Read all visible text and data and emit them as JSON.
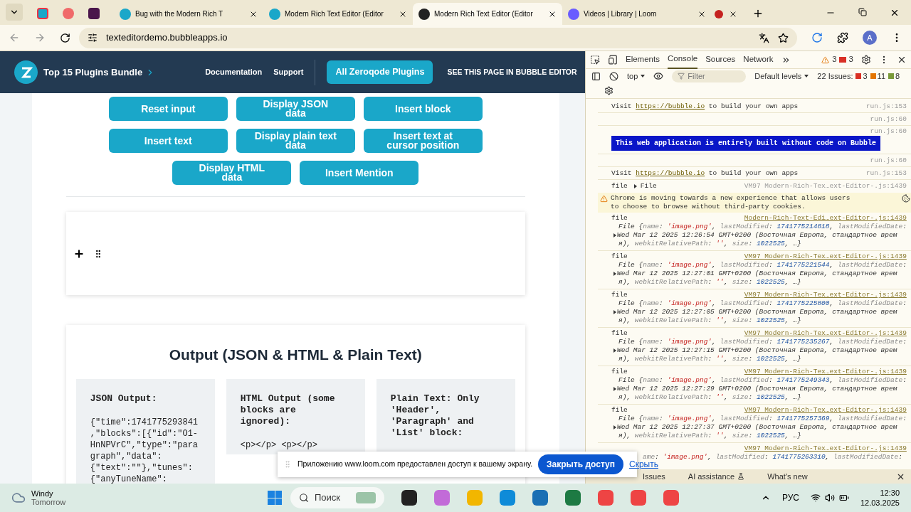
{
  "browser": {
    "tabs": [
      {
        "title": "Bug with the Modern Rich T",
        "selected": false
      },
      {
        "title": "Modern Rich Text Editor (Editor",
        "selected": false
      },
      {
        "title": "Modern Rich Text Editor (Editor",
        "selected": true
      },
      {
        "title": "Videos | Library | Loom",
        "selected": false
      }
    ],
    "url": "texteditordemo.bubbleapps.io",
    "profile": "A"
  },
  "page": {
    "brand": "Top 15 Plugins Bundle",
    "nav": [
      "Documentation",
      "Support"
    ],
    "cta": "All Zeroqode Plugins",
    "editor_link": "SEE THIS PAGE IN BUBBLE EDITOR",
    "button_rows": [
      [
        "Reset input",
        "Display JSON data",
        "Insert block"
      ],
      [
        "Insert text",
        "Display plain text data",
        "Insert text at cursor position"
      ],
      [
        "Display HTML data",
        "Insert Mention"
      ]
    ],
    "output_title": "Output (JSON & HTML & Plain Text)",
    "panels": [
      {
        "heading": "JSON Output:",
        "lines": [
          "{\"time\":1741775293841",
          ",\"blocks\":[{\"id\":\"O1-",
          "HnNPVrC\",\"type\":\"para",
          "graph\",\"data\":",
          "{\"text\":\"\"},\"tunes\":",
          "{\"anyTuneName\":"
        ]
      },
      {
        "heading": "HTML Output (some blocks are ignored):",
        "lines": [
          "<p></p> <p></p>"
        ]
      },
      {
        "heading": "Plain Text: Only 'Header', 'Paragraph' and 'List' block:"
      }
    ]
  },
  "devtools": {
    "tabs": [
      {
        "label": "Elements",
        "selected": false
      },
      {
        "label": "Console",
        "selected": true
      },
      {
        "label": "Sources",
        "selected": false
      },
      {
        "label": "Network",
        "selected": false
      }
    ],
    "warnings": "3",
    "errors": "3",
    "context": "top",
    "filter_placeholder": "Filter",
    "levels": "Default levels",
    "issues_label": "22 Issues:",
    "issue_counts": [
      "3",
      "11",
      "8"
    ],
    "messages": [
      {
        "kind": "visit",
        "before": "Visit ",
        "link": "https://bubble.io",
        "after": " to build your own apps",
        "source": "run.js:153"
      },
      {
        "kind": "empty",
        "source": "run.js:60"
      },
      {
        "kind": "banner",
        "source": "run.js:60",
        "text": "This web application is entirely built without code on Bubble"
      },
      {
        "kind": "empty",
        "source": "run.js:60"
      },
      {
        "kind": "visit",
        "before": "Visit ",
        "link": "https://bubble.io",
        "after": " to build your own apps",
        "source": "run.js:153"
      },
      {
        "kind": "collapsed",
        "label": "file",
        "summary": "File",
        "source": "VM97 Modern-Rich-Tex…ext-Editor-.js:1439"
      },
      {
        "kind": "warning",
        "text": "Chrome is moving towards a new experience that allows users to choose to browse without third-party cookies."
      },
      {
        "kind": "file",
        "label": "file",
        "source": "Modern-Rich-Text-Edi…ext-Editor-.js:1439",
        "lines": [
          [
            {
              "kind": "p",
              "t": "File {"
            },
            {
              "kind": "key",
              "t": "name"
            },
            {
              "kind": "p",
              "t": ": "
            },
            {
              "kind": "str",
              "t": "'image.png'"
            },
            {
              "kind": "p",
              "t": ", "
            },
            {
              "kind": "key",
              "t": "lastModified"
            },
            {
              "kind": "p",
              "t": ": "
            },
            {
              "kind": "num",
              "t": "1741775214818"
            },
            {
              "kind": "p",
              "t": ", "
            },
            {
              "kind": "key",
              "t": "lastModifiedDate"
            },
            {
              "kind": "p",
              "t": ":"
            }
          ],
          [
            {
              "kind": "p",
              "t": "Wed Mar 12 2025 12:26:54 GMT+0200 (Восточная Европа, стандартное врем"
            }
          ],
          [
            {
              "kind": "p",
              "t": "я), "
            },
            {
              "kind": "key",
              "t": "webkitRelativePath"
            },
            {
              "kind": "p",
              "t": ": "
            },
            {
              "kind": "str",
              "t": "''"
            },
            {
              "kind": "p",
              "t": ", "
            },
            {
              "kind": "key",
              "t": "size"
            },
            {
              "kind": "p",
              "t": ": "
            },
            {
              "kind": "num",
              "t": "1022525"
            },
            {
              "kind": "p",
              "t": ", …}"
            }
          ]
        ]
      },
      {
        "kind": "file",
        "label": "file",
        "source": "VM97 Modern-Rich-Tex…ext-Editor-.js:1439",
        "lines": [
          [
            {
              "kind": "p",
              "t": "File {"
            },
            {
              "kind": "key",
              "t": "name"
            },
            {
              "kind": "p",
              "t": ": "
            },
            {
              "kind": "str",
              "t": "'image.png'"
            },
            {
              "kind": "p",
              "t": ", "
            },
            {
              "kind": "key",
              "t": "lastModified"
            },
            {
              "kind": "p",
              "t": ": "
            },
            {
              "kind": "num",
              "t": "1741775221544"
            },
            {
              "kind": "p",
              "t": ", "
            },
            {
              "kind": "key",
              "t": "lastModifiedDate"
            },
            {
              "kind": "p",
              "t": ":"
            }
          ],
          [
            {
              "kind": "p",
              "t": "Wed Mar 12 2025 12:27:01 GMT+0200 (Восточная Европа, стандартное врем"
            }
          ],
          [
            {
              "kind": "p",
              "t": "я), "
            },
            {
              "kind": "key",
              "t": "webkitRelativePath"
            },
            {
              "kind": "p",
              "t": ": "
            },
            {
              "kind": "str",
              "t": "''"
            },
            {
              "kind": "p",
              "t": ", "
            },
            {
              "kind": "key",
              "t": "size"
            },
            {
              "kind": "p",
              "t": ": "
            },
            {
              "kind": "num",
              "t": "1022525"
            },
            {
              "kind": "p",
              "t": ", …}"
            }
          ]
        ]
      },
      {
        "kind": "file",
        "label": "file",
        "source": "VM97 Modern-Rich-Tex…ext-Editor-.js:1439",
        "lines": [
          [
            {
              "kind": "p",
              "t": "File {"
            },
            {
              "kind": "key",
              "t": "name"
            },
            {
              "kind": "p",
              "t": ": "
            },
            {
              "kind": "str",
              "t": "'image.png'"
            },
            {
              "kind": "p",
              "t": ", "
            },
            {
              "kind": "key",
              "t": "lastModified"
            },
            {
              "kind": "p",
              "t": ": "
            },
            {
              "kind": "num",
              "t": "1741775225800"
            },
            {
              "kind": "p",
              "t": ", "
            },
            {
              "kind": "key",
              "t": "lastModifiedDate"
            },
            {
              "kind": "p",
              "t": ":"
            }
          ],
          [
            {
              "kind": "p",
              "t": "Wed Mar 12 2025 12:27:05 GMT+0200 (Восточная Европа, стандартное врем"
            }
          ],
          [
            {
              "kind": "p",
              "t": "я), "
            },
            {
              "kind": "key",
              "t": "webkitRelativePath"
            },
            {
              "kind": "p",
              "t": ": "
            },
            {
              "kind": "str",
              "t": "''"
            },
            {
              "kind": "p",
              "t": ", "
            },
            {
              "kind": "key",
              "t": "size"
            },
            {
              "kind": "p",
              "t": ": "
            },
            {
              "kind": "num",
              "t": "1022525"
            },
            {
              "kind": "p",
              "t": ", …}"
            }
          ]
        ]
      },
      {
        "kind": "file",
        "label": "file",
        "source": "VM97 Modern-Rich-Tex…ext-Editor-.js:1439",
        "lines": [
          [
            {
              "kind": "p",
              "t": "File {"
            },
            {
              "kind": "key",
              "t": "name"
            },
            {
              "kind": "p",
              "t": ": "
            },
            {
              "kind": "str",
              "t": "'image.png'"
            },
            {
              "kind": "p",
              "t": ", "
            },
            {
              "kind": "key",
              "t": "lastModified"
            },
            {
              "kind": "p",
              "t": ": "
            },
            {
              "kind": "num",
              "t": "1741775235267"
            },
            {
              "kind": "p",
              "t": ", "
            },
            {
              "kind": "key",
              "t": "lastModifiedDate"
            },
            {
              "kind": "p",
              "t": ":"
            }
          ],
          [
            {
              "kind": "p",
              "t": "Wed Mar 12 2025 12:27:15 GMT+0200 (Восточная Европа, стандартное врем"
            }
          ],
          [
            {
              "kind": "p",
              "t": "я), "
            },
            {
              "kind": "key",
              "t": "webkitRelativePath"
            },
            {
              "kind": "p",
              "t": ": "
            },
            {
              "kind": "str",
              "t": "''"
            },
            {
              "kind": "p",
              "t": ", "
            },
            {
              "kind": "key",
              "t": "size"
            },
            {
              "kind": "p",
              "t": ": "
            },
            {
              "kind": "num",
              "t": "1022525"
            },
            {
              "kind": "p",
              "t": ", …}"
            }
          ]
        ]
      },
      {
        "kind": "file",
        "label": "file",
        "source": "VM97 Modern-Rich-Tex…ext-Editor-.js:1439",
        "lines": [
          [
            {
              "kind": "p",
              "t": "File {"
            },
            {
              "kind": "key",
              "t": "name"
            },
            {
              "kind": "p",
              "t": ": "
            },
            {
              "kind": "str",
              "t": "'image.png'"
            },
            {
              "kind": "p",
              "t": ", "
            },
            {
              "kind": "key",
              "t": "lastModified"
            },
            {
              "kind": "p",
              "t": ": "
            },
            {
              "kind": "num",
              "t": "1741775249343"
            },
            {
              "kind": "p",
              "t": ", "
            },
            {
              "kind": "key",
              "t": "lastModifiedDate"
            },
            {
              "kind": "p",
              "t": ":"
            }
          ],
          [
            {
              "kind": "p",
              "t": "Wed Mar 12 2025 12:27:29 GMT+0200 (Восточная Европа, стандартное врем"
            }
          ],
          [
            {
              "kind": "p",
              "t": "я), "
            },
            {
              "kind": "key",
              "t": "webkitRelativePath"
            },
            {
              "kind": "p",
              "t": ": "
            },
            {
              "kind": "str",
              "t": "''"
            },
            {
              "kind": "p",
              "t": ", "
            },
            {
              "kind": "key",
              "t": "size"
            },
            {
              "kind": "p",
              "t": ": "
            },
            {
              "kind": "num",
              "t": "1022525"
            },
            {
              "kind": "p",
              "t": ", …}"
            }
          ]
        ]
      },
      {
        "kind": "file",
        "label": "file",
        "source": "VM97 Modern-Rich-Tex…ext-Editor-.js:1439",
        "lines": [
          [
            {
              "kind": "p",
              "t": "File {"
            },
            {
              "kind": "key",
              "t": "name"
            },
            {
              "kind": "p",
              "t": ": "
            },
            {
              "kind": "str",
              "t": "'image.png'"
            },
            {
              "kind": "p",
              "t": ", "
            },
            {
              "kind": "key",
              "t": "lastModified"
            },
            {
              "kind": "p",
              "t": ": "
            },
            {
              "kind": "num",
              "t": "1741775257369"
            },
            {
              "kind": "p",
              "t": ", "
            },
            {
              "kind": "key",
              "t": "lastModifiedDate"
            },
            {
              "kind": "p",
              "t": ":"
            }
          ],
          [
            {
              "kind": "p",
              "t": "Wed Mar 12 2025 12:27:37 GMT+0200 (Восточная Европа, стандартное врем"
            }
          ],
          [
            {
              "kind": "p",
              "t": "я), "
            },
            {
              "kind": "key",
              "t": "webkitRelativePath"
            },
            {
              "kind": "p",
              "t": ": "
            },
            {
              "kind": "str",
              "t": "''"
            },
            {
              "kind": "p",
              "t": ", "
            },
            {
              "kind": "key",
              "t": "size"
            },
            {
              "kind": "p",
              "t": ": "
            },
            {
              "kind": "num",
              "t": "1022525"
            },
            {
              "kind": "p",
              "t": ", …}"
            }
          ]
        ]
      },
      {
        "kind": "partial",
        "source": "VM97 Modern-Rich-Tex…ext-Editor-.js:1439",
        "lines": [
          [
            {
              "kind": "key",
              "t": "ame"
            },
            {
              "kind": "p",
              "t": ": "
            },
            {
              "kind": "str",
              "t": "'image.png'"
            },
            {
              "kind": "p",
              "t": ", "
            },
            {
              "kind": "key",
              "t": "lastModified"
            },
            {
              "kind": "p",
              "t": ": "
            },
            {
              "kind": "num",
              "t": "1741775263310"
            },
            {
              "kind": "p",
              "t": ", "
            },
            {
              "kind": "key",
              "t": "lastModifiedDate"
            },
            {
              "kind": "p",
              "t": ":"
            }
          ]
        ]
      }
    ],
    "drawer_tabs": [
      "Issues",
      "AI assistance",
      "What's new"
    ]
  },
  "loom_bar": {
    "text": "Приложению www.loom.com предоставлен доступ к вашему экрану.",
    "stop": "Закрыть доступ",
    "hide": "Скрыть"
  },
  "taskbar": {
    "weather": "Windy",
    "weather_sub": "Tomorrow",
    "search_placeholder": "Поиск",
    "language": "РУС",
    "time": "12:30",
    "date": "12.03.2025"
  }
}
